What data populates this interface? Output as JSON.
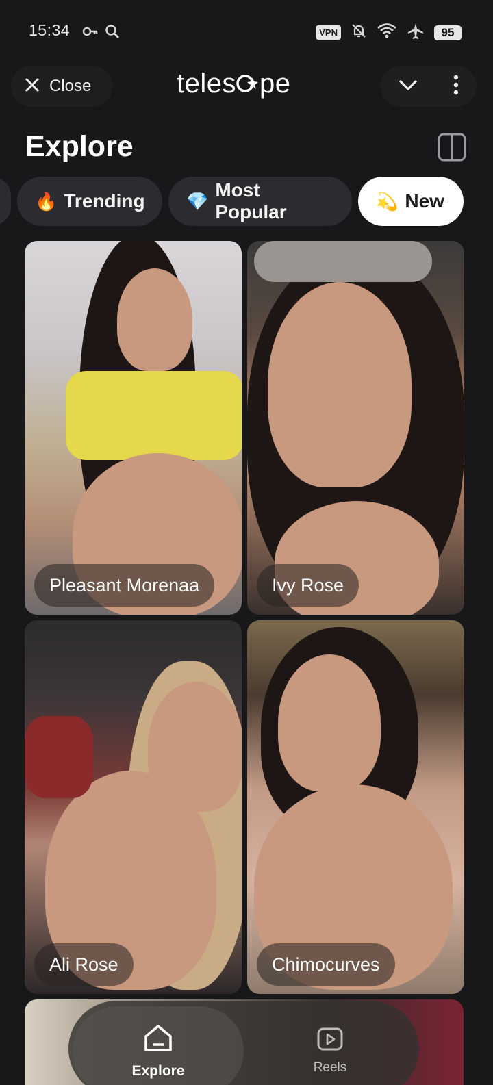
{
  "status_bar": {
    "time": "15:34",
    "vpn": "VPN",
    "battery": "95",
    "left_icons": [
      "key-icon",
      "search-icon"
    ],
    "right_icons": [
      "vpn-badge",
      "bell-off-icon",
      "wifi-icon",
      "airplane-icon",
      "battery-icon"
    ]
  },
  "top_bar": {
    "close_label": "Close",
    "brand_prefix": "teles",
    "brand_suffix": "pe"
  },
  "header": {
    "title": "Explore"
  },
  "chips": [
    {
      "emoji": "🔥",
      "label": "Trending"
    },
    {
      "emoji": "💎",
      "label": "Most Popular"
    },
    {
      "emoji": "💫",
      "label": "New"
    }
  ],
  "cards": [
    {
      "name": "Pleasant Morenaa"
    },
    {
      "name": "Ivy Rose"
    },
    {
      "name": "Ali Rose"
    },
    {
      "name": "Chimocurves"
    }
  ],
  "bottom_nav": {
    "items": [
      {
        "label": "Explore",
        "icon": "home-icon",
        "active": true
      },
      {
        "label": "Reels",
        "icon": "play-icon",
        "active": false
      }
    ]
  },
  "colors": {
    "background": "#18181a",
    "chip": "#2c2c30",
    "chip_active": "#ffffff"
  }
}
